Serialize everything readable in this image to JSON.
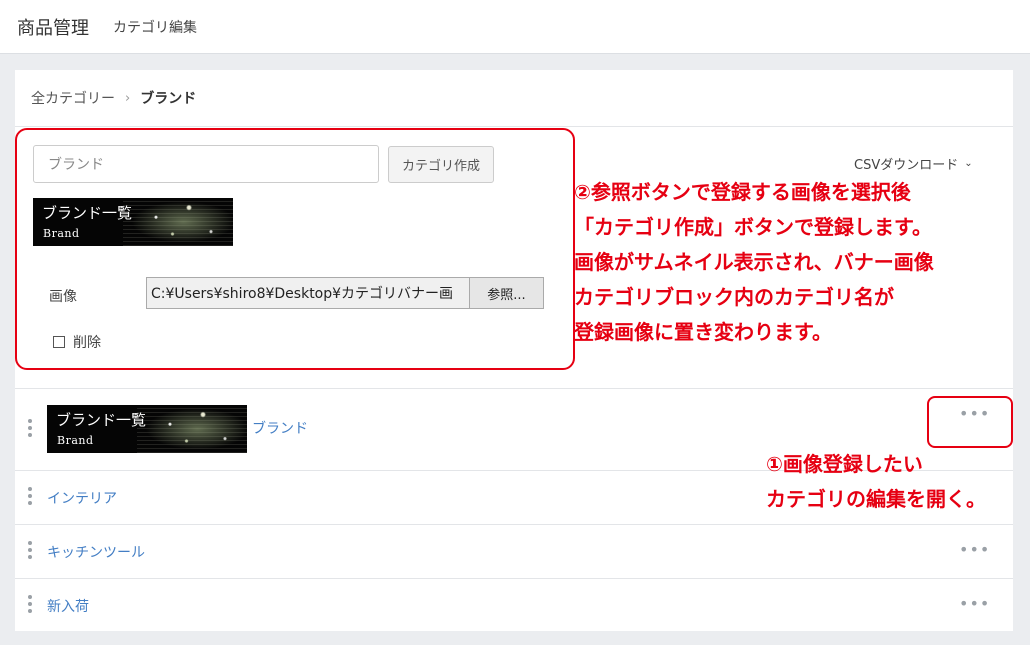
{
  "header": {
    "title": "商品管理",
    "subtitle": "カテゴリ編集"
  },
  "breadcrumb": {
    "root": "全カテゴリー",
    "separator": "›",
    "current": "ブランド"
  },
  "create_form": {
    "name_value": "ブランド",
    "create_button": "カテゴリ作成",
    "banner": {
      "title": "ブランド一覧",
      "subtitle": "Brand"
    },
    "image_label": "画像",
    "file_path": "C:¥Users¥shiro8¥Desktop¥カテゴリバナー画",
    "browse_button": "参照...",
    "delete_label": "削除",
    "delete_checked": false
  },
  "csv_download": {
    "label": "CSVダウンロード",
    "icon": "chevron-down-icon"
  },
  "annotations": {
    "note2": [
      "②参照ボタンで登録する画像を選択後",
      "「カテゴリ作成」ボタンで登録します。",
      "画像がサムネイル表示され、バナー画像",
      "カテゴリブロック内のカテゴリ名が",
      "登録画像に置き変わります。"
    ],
    "note1": [
      "①画像登録したい",
      "カテゴリの編集を開く。"
    ],
    "color": "#e60012"
  },
  "categories": [
    {
      "name": "ブランド",
      "banner": {
        "title": "ブランド一覧",
        "subtitle": "Brand"
      },
      "more": "•••"
    },
    {
      "name": "インテリア"
    },
    {
      "name": "キッチンツール",
      "more": "•••"
    },
    {
      "name": "新入荷",
      "more": "•••"
    }
  ],
  "colors": {
    "link": "#437ec4",
    "accent": "#e60012",
    "background": "#ebedf0"
  }
}
